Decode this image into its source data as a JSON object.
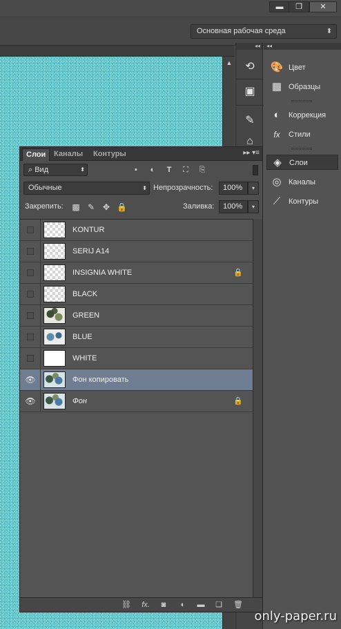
{
  "window": {
    "minimize": "▬",
    "restore": "❐",
    "close": "✕"
  },
  "options": {
    "workspace": "Основная рабочая среда"
  },
  "right_panels": [
    {
      "label": "Цвет",
      "icon": "palette-icon",
      "glyph": "🎨"
    },
    {
      "label": "Образцы",
      "icon": "swatches-icon",
      "glyph": "▦"
    },
    {
      "label": "Коррекция",
      "icon": "adjustments-icon",
      "glyph": "◐"
    },
    {
      "label": "Стили",
      "icon": "styles-icon",
      "glyph": "fx"
    },
    {
      "label": "Слои",
      "icon": "layers-icon",
      "glyph": "◈"
    },
    {
      "label": "Каналы",
      "icon": "channels-icon",
      "glyph": "◎"
    },
    {
      "label": "Контуры",
      "icon": "paths-icon",
      "glyph": "⟋"
    }
  ],
  "layers_panel": {
    "tabs": [
      "Слои",
      "Каналы",
      "Контуры"
    ],
    "filter_kind": "Вид",
    "blend_mode": "Обычные",
    "opacity_label": "Непрозрачность:",
    "opacity_value": "100%",
    "lock_label": "Закрепить:",
    "fill_label": "Заливка:",
    "fill_value": "100%",
    "layers": [
      {
        "name": "KONTUR",
        "visible": false,
        "selected": false,
        "locked": false,
        "thumb": "transparent"
      },
      {
        "name": "SERIJ A14",
        "visible": false,
        "selected": false,
        "locked": false,
        "thumb": "transparent"
      },
      {
        "name": "INSIGNIA WHITE",
        "visible": false,
        "selected": false,
        "locked": true,
        "thumb": "transparent"
      },
      {
        "name": "BLACK",
        "visible": false,
        "selected": false,
        "locked": false,
        "thumb": "transparent"
      },
      {
        "name": "GREEN",
        "visible": false,
        "selected": false,
        "locked": false,
        "thumb": "camo"
      },
      {
        "name": "BLUE",
        "visible": false,
        "selected": false,
        "locked": false,
        "thumb": "blue"
      },
      {
        "name": "WHITE",
        "visible": false,
        "selected": false,
        "locked": false,
        "thumb": "white"
      },
      {
        "name": "Фон копировать",
        "visible": true,
        "selected": true,
        "locked": false,
        "thumb": "full"
      },
      {
        "name": "Фон",
        "visible": true,
        "selected": false,
        "locked": true,
        "thumb": "full",
        "italic": true
      }
    ]
  },
  "watermark": "only-paper.ru",
  "colors": {
    "selected_row": "#6e7d92",
    "panel_bg": "#535353"
  }
}
